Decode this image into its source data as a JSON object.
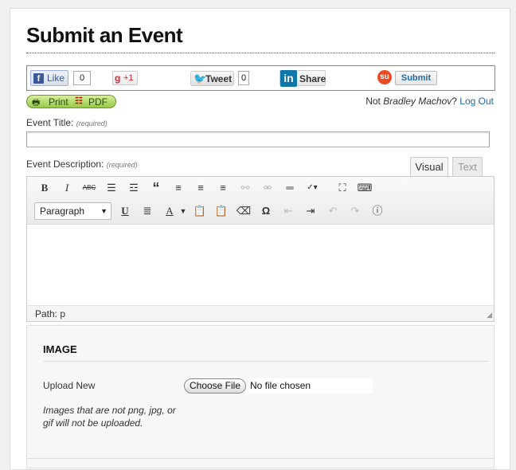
{
  "page": {
    "title": "Submit an Event"
  },
  "share": {
    "like_label": "Like",
    "like_count": "0",
    "gplus_label": "+1",
    "tweet_label": "Tweet",
    "tweet_count": "0",
    "linkedin_label": "Share",
    "stumble_label": "Submit"
  },
  "print": {
    "print_label": "Print",
    "pdf_label": "PDF"
  },
  "user": {
    "not_prefix": "Not ",
    "name": "Bradley Machov",
    "question": "?",
    "logout": "Log Out"
  },
  "form": {
    "title_label": "Event Title:",
    "title_required": "(required)",
    "title_value": "",
    "desc_label": "Event Description:",
    "desc_required": "(required)"
  },
  "editor": {
    "tabs": [
      "Visual",
      "Text"
    ],
    "format_value": "Paragraph",
    "path": "Path: p",
    "icons_row1": [
      "bold-icon",
      "italic-icon",
      "strikethrough-icon",
      "bullet-list-icon",
      "numbered-list-icon",
      "blockquote-icon",
      "align-left-icon",
      "align-center-icon",
      "align-right-icon",
      "link-icon",
      "unlink-icon",
      "more-tag-icon",
      "spellcheck-icon",
      "fullscreen-icon",
      "kitchen-sink-icon"
    ],
    "icons_row2": [
      "underline-icon",
      "justify-icon",
      "text-color-icon",
      "paste-text-icon",
      "paste-word-icon",
      "clear-format-icon",
      "special-char-icon",
      "outdent-icon",
      "indent-icon",
      "undo-icon",
      "redo-icon",
      "help-icon"
    ]
  },
  "image": {
    "heading": "IMAGE",
    "upload_label": "Upload New",
    "choose_button": "Choose File",
    "file_status": "No file chosen",
    "note": "Images that are not png, jpg, or gif will not be uploaded."
  },
  "colors": {
    "accent": "#1e6ba8",
    "facebook": "#3b5998",
    "linkedin": "#0e76a8",
    "print_green": "#98c84a"
  }
}
